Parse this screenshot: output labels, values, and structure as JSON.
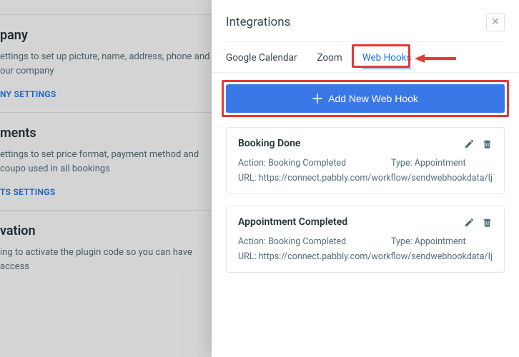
{
  "background": {
    "sections": [
      {
        "title": "pany",
        "desc": "ettings to set up picture, name, address, phone and our company",
        "link": "NY SETTINGS"
      },
      {
        "title": "ments",
        "desc": "ettings to set price format, payment method and coupo used in all bookings",
        "link": "TS SETTINGS"
      },
      {
        "title": "vation",
        "desc": "ing to activate the plugin code so you can have access",
        "link": ""
      }
    ]
  },
  "panel": {
    "title": "Integrations",
    "tabs": [
      "Google Calendar",
      "Zoom",
      "Web Hooks"
    ],
    "active_tab": 2,
    "add_button": "Add New Web Hook",
    "hooks": [
      {
        "title": "Booking Done",
        "action_label": "Action: Booking Completed",
        "type_label": "Type: Appointment",
        "url_label": "URL: https://connect.pabbly.com/workflow/sendwebhookdata/IjkwNzMi"
      },
      {
        "title": "Appointment Completed",
        "action_label": "Action: Booking Completed",
        "type_label": "Type: Appointment",
        "url_label": "URL: https://connect.pabbly.com/workflow/sendwebhookdata/IjkxOTMi"
      }
    ]
  },
  "colors": {
    "accent": "#1a73e8",
    "primary_button": "#3b78e7",
    "highlight": "#e53935"
  }
}
